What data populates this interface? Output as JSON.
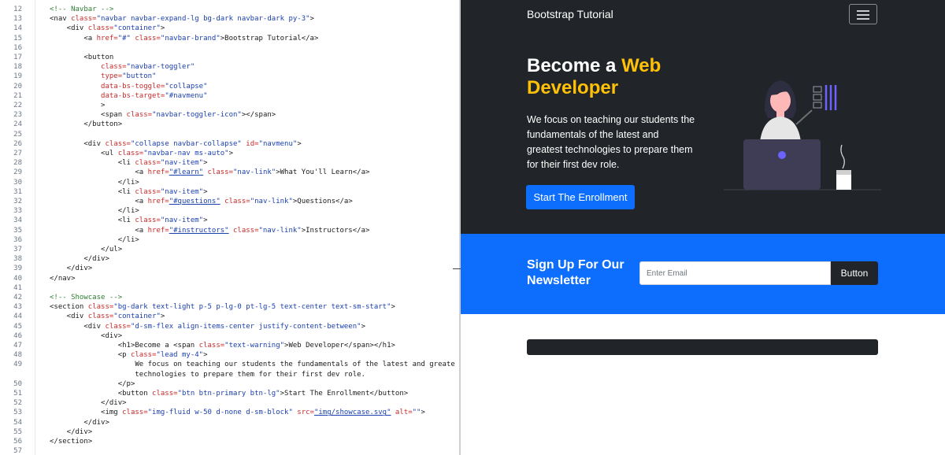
{
  "editor": {
    "lines": [
      {
        "n": "12",
        "segs": [
          [
            "com",
            "<!-- Navbar -->"
          ]
        ]
      },
      {
        "n": "13",
        "segs": [
          [
            "tag",
            "<nav "
          ],
          [
            "attr",
            "class="
          ],
          [
            "str",
            "\"navbar navbar-expand-lg bg-dark navbar-dark py-3\""
          ],
          [
            "tag",
            ">"
          ]
        ]
      },
      {
        "n": "14",
        "segs": [
          [
            "tag",
            "    <div "
          ],
          [
            "attr",
            "class="
          ],
          [
            "str",
            "\"container\""
          ],
          [
            "tag",
            ">"
          ]
        ]
      },
      {
        "n": "15",
        "segs": [
          [
            "tag",
            "        <a "
          ],
          [
            "attr",
            "href="
          ],
          [
            "str",
            "\"#\""
          ],
          [
            "attr",
            " class="
          ],
          [
            "str",
            "\"navbar-brand\""
          ],
          [
            "tag",
            ">Bootstrap Tutorial</a>"
          ]
        ]
      },
      {
        "n": "16",
        "segs": []
      },
      {
        "n": "17",
        "segs": [
          [
            "tag",
            "        <button"
          ]
        ]
      },
      {
        "n": "18",
        "segs": [
          [
            "attr",
            "            class="
          ],
          [
            "str",
            "\"navbar-toggler\""
          ]
        ]
      },
      {
        "n": "19",
        "segs": [
          [
            "attr",
            "            type="
          ],
          [
            "str",
            "\"button\""
          ]
        ]
      },
      {
        "n": "20",
        "segs": [
          [
            "attr",
            "            data-bs-toggle="
          ],
          [
            "str",
            "\"collapse\""
          ]
        ]
      },
      {
        "n": "21",
        "segs": [
          [
            "attr",
            "            data-bs-target="
          ],
          [
            "str",
            "\"#navmenu\""
          ]
        ]
      },
      {
        "n": "22",
        "segs": [
          [
            "tag",
            "            >"
          ]
        ]
      },
      {
        "n": "23",
        "segs": [
          [
            "tag",
            "            <span "
          ],
          [
            "attr",
            "class="
          ],
          [
            "str",
            "\"navbar-toggler-icon\""
          ],
          [
            "tag",
            "></span>"
          ]
        ]
      },
      {
        "n": "24",
        "segs": [
          [
            "tag",
            "        </button>"
          ]
        ]
      },
      {
        "n": "25",
        "segs": []
      },
      {
        "n": "26",
        "segs": [
          [
            "tag",
            "        <div "
          ],
          [
            "attr",
            "class="
          ],
          [
            "str",
            "\"collapse navbar-collapse\""
          ],
          [
            "attr",
            " id="
          ],
          [
            "str",
            "\"navmenu\""
          ],
          [
            "tag",
            ">"
          ]
        ]
      },
      {
        "n": "27",
        "segs": [
          [
            "tag",
            "            <ul "
          ],
          [
            "attr",
            "class="
          ],
          [
            "str",
            "\"navbar-nav ms-auto\""
          ],
          [
            "tag",
            ">"
          ]
        ]
      },
      {
        "n": "28",
        "segs": [
          [
            "tag",
            "                <li "
          ],
          [
            "attr",
            "class="
          ],
          [
            "str",
            "\"nav-item\""
          ],
          [
            "tag",
            ">"
          ]
        ]
      },
      {
        "n": "29",
        "segs": [
          [
            "tag",
            "                    <a "
          ],
          [
            "attr",
            "href="
          ],
          [
            "link",
            "\"#learn\""
          ],
          [
            "attr",
            " class="
          ],
          [
            "str",
            "\"nav-link\""
          ],
          [
            "tag",
            ">What You'll Learn</a>"
          ]
        ]
      },
      {
        "n": "30",
        "segs": [
          [
            "tag",
            "                </li>"
          ]
        ]
      },
      {
        "n": "31",
        "segs": [
          [
            "tag",
            "                <li "
          ],
          [
            "attr",
            "class="
          ],
          [
            "str",
            "\"nav-item\""
          ],
          [
            "tag",
            ">"
          ]
        ]
      },
      {
        "n": "32",
        "segs": [
          [
            "tag",
            "                    <a "
          ],
          [
            "attr",
            "href="
          ],
          [
            "link",
            "\"#questions\""
          ],
          [
            "attr",
            " class="
          ],
          [
            "str",
            "\"nav-link\""
          ],
          [
            "tag",
            ">Questions</a>"
          ]
        ]
      },
      {
        "n": "33",
        "segs": [
          [
            "tag",
            "                </li>"
          ]
        ]
      },
      {
        "n": "34",
        "segs": [
          [
            "tag",
            "                <li "
          ],
          [
            "attr",
            "class="
          ],
          [
            "str",
            "\"nav-item\""
          ],
          [
            "tag",
            ">"
          ]
        ]
      },
      {
        "n": "35",
        "segs": [
          [
            "tag",
            "                    <a "
          ],
          [
            "attr",
            "href="
          ],
          [
            "link",
            "\"#instructors\""
          ],
          [
            "attr",
            " class="
          ],
          [
            "str",
            "\"nav-link\""
          ],
          [
            "tag",
            ">Instructors</a>"
          ]
        ]
      },
      {
        "n": "36",
        "segs": [
          [
            "tag",
            "                </li>"
          ]
        ]
      },
      {
        "n": "37",
        "segs": [
          [
            "tag",
            "            </ul>"
          ]
        ]
      },
      {
        "n": "38",
        "segs": [
          [
            "tag",
            "        </div>"
          ]
        ]
      },
      {
        "n": "39",
        "segs": [
          [
            "tag",
            "    </div>"
          ]
        ]
      },
      {
        "n": "40",
        "segs": [
          [
            "tag",
            "</nav>"
          ]
        ]
      },
      {
        "n": "41",
        "segs": []
      },
      {
        "n": "42",
        "segs": [
          [
            "com",
            "<!-- Showcase -->"
          ]
        ]
      },
      {
        "n": "43",
        "segs": [
          [
            "tag",
            "<section "
          ],
          [
            "attr",
            "class="
          ],
          [
            "str",
            "\"bg-dark text-light p-5 p-lg-0 pt-lg-5 text-center text-sm-start\""
          ],
          [
            "tag",
            ">"
          ]
        ]
      },
      {
        "n": "44",
        "segs": [
          [
            "tag",
            "    <div "
          ],
          [
            "attr",
            "class="
          ],
          [
            "str",
            "\"container\""
          ],
          [
            "tag",
            ">"
          ]
        ]
      },
      {
        "n": "45",
        "segs": [
          [
            "tag",
            "        <div "
          ],
          [
            "attr",
            "class="
          ],
          [
            "str",
            "\"d-sm-flex align-items-center justify-content-between\""
          ],
          [
            "tag",
            ">"
          ]
        ]
      },
      {
        "n": "46",
        "segs": [
          [
            "tag",
            "            <div>"
          ]
        ]
      },
      {
        "n": "47",
        "segs": [
          [
            "tag",
            "                <h1>Become a <span "
          ],
          [
            "attr",
            "class="
          ],
          [
            "str",
            "\"text-warning\""
          ],
          [
            "tag",
            ">Web Developer</span></h1>"
          ]
        ]
      },
      {
        "n": "48",
        "segs": [
          [
            "tag",
            "                <p "
          ],
          [
            "attr",
            "class="
          ],
          [
            "str",
            "\"lead my-4\""
          ],
          [
            "tag",
            ">"
          ]
        ]
      },
      {
        "n": "49",
        "segs": [
          [
            "txt",
            "                    We focus on teaching our students the fundamentals of the latest and greatest"
          ]
        ]
      },
      {
        "n": "",
        "segs": [
          [
            "txt",
            "                    technologies to prepare them for their first dev role."
          ]
        ]
      },
      {
        "n": "50",
        "segs": [
          [
            "tag",
            "                </p>"
          ]
        ]
      },
      {
        "n": "51",
        "segs": [
          [
            "tag",
            "                <button "
          ],
          [
            "attr",
            "class="
          ],
          [
            "str",
            "\"btn btn-primary btn-lg\""
          ],
          [
            "tag",
            ">Start The Enrollment</button>"
          ]
        ]
      },
      {
        "n": "52",
        "segs": [
          [
            "tag",
            "            </div>"
          ]
        ]
      },
      {
        "n": "53",
        "segs": [
          [
            "tag",
            "            <img "
          ],
          [
            "attr",
            "class="
          ],
          [
            "str",
            "\"img-fluid w-50 d-none d-sm-block\""
          ],
          [
            "attr",
            " src="
          ],
          [
            "link",
            "\"img/showcase.svg\""
          ],
          [
            "attr",
            " alt="
          ],
          [
            "str",
            "\"\""
          ],
          [
            "tag",
            ">"
          ]
        ]
      },
      {
        "n": "54",
        "segs": [
          [
            "tag",
            "        </div>"
          ]
        ]
      },
      {
        "n": "55",
        "segs": [
          [
            "tag",
            "    </div>"
          ]
        ]
      },
      {
        "n": "56",
        "segs": [
          [
            "tag",
            "</section>"
          ]
        ]
      },
      {
        "n": "57",
        "segs": []
      }
    ]
  },
  "preview": {
    "navbar": {
      "brand": "Bootstrap Tutorial",
      "toggler_icon": "hamburger-icon"
    },
    "hero": {
      "title_prefix": "Become a ",
      "title_highlight": "Web Developer",
      "lead": "We focus on teaching our students the fundamentals of the latest and greatest technologies to prepare them for their first dev role.",
      "button": "Start The Enrollment"
    },
    "newsletter": {
      "title": "Sign Up For Our Newsletter",
      "placeholder": "Enter Email",
      "button": "Button"
    }
  },
  "colors": {
    "dark": "#212529",
    "primary": "#0d6efd",
    "warning": "#ffc107",
    "illustration_accent": "#6c63ff"
  }
}
